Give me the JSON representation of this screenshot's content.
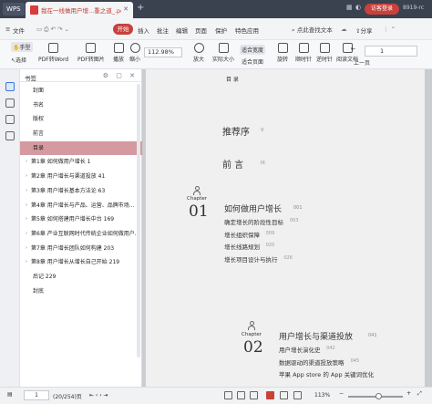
{
  "titlebar": {
    "app_name": "WPS",
    "doc_tab_title": "我在一线做用户增...重之道_.pdf",
    "tab_close": "✕",
    "tab_add": "+",
    "login_label": "访客登录",
    "user_id": "8919-rc"
  },
  "menubar": {
    "file_label": "文件",
    "items": [
      "开始",
      "插入",
      "批注",
      "编辑",
      "页面",
      "保护",
      "特色应用"
    ],
    "start_label": "开始",
    "search_label": "点此查找文本",
    "share_label": "分享"
  },
  "toolbar": {
    "hand_label": "手型",
    "select_label": "选择",
    "pdf_to_word": "PDF转Word",
    "pdf_to_image": "PDF转图片",
    "play_label": "播放",
    "zoom_out_label": "缩小",
    "zoom_value": "112.98%",
    "zoom_in_label": "放大",
    "actual_size_label": "实际大小",
    "fit_width_label": "适合宽度",
    "fit_page_label": "适合页面",
    "rotate_left_label": "旋转",
    "rotate_right_label": "顺时针",
    "view_options_label": "逆时针",
    "read_label": "阅读文档",
    "prev_label": "上一页",
    "page_input": "1"
  },
  "bookmarks": {
    "title": "书签",
    "tools": "⚙ ▢ ✕",
    "items": [
      {
        "label": "封面",
        "expandable": false,
        "selected": false
      },
      {
        "label": "书名",
        "expandable": false,
        "selected": false
      },
      {
        "label": "版权",
        "expandable": false,
        "selected": false
      },
      {
        "label": "前言",
        "expandable": false,
        "selected": false
      },
      {
        "label": "目录",
        "expandable": false,
        "selected": true
      },
      {
        "label": "第1章 如何做用户增长  1",
        "expandable": true,
        "selected": false
      },
      {
        "label": "第2章 用户增长与渠道投放  41",
        "expandable": true,
        "selected": false
      },
      {
        "label": "第3章 用户增长基本方法论  63",
        "expandable": true,
        "selected": false
      },
      {
        "label": "第4章 用户增长与产品、运营、品牌市场...",
        "expandable": true,
        "selected": false
      },
      {
        "label": "第5章 如何搭建用户增长中台  169",
        "expandable": true,
        "selected": false
      },
      {
        "label": "第6章 产业互联网时代传统企业如何做用户...",
        "expandable": true,
        "selected": false
      },
      {
        "label": "第7章 用户增长团队如何构建  203",
        "expandable": true,
        "selected": false
      },
      {
        "label": "第8章 用户增长从增长自己开始  219",
        "expandable": true,
        "selected": false
      },
      {
        "label": "后记  229",
        "expandable": false,
        "selected": false
      },
      {
        "label": "封底",
        "expandable": false,
        "selected": false
      }
    ]
  },
  "page": {
    "header": "目  录",
    "recommend": "推荐序",
    "recommend_page": "V",
    "preface": "前  言",
    "preface_page": "IX",
    "chapter_word": "Chapter",
    "ch1_num": "01",
    "ch1_title": "如何做用户增长",
    "ch1_title_page": "001",
    "ch1_sections": [
      {
        "label": "确定增长的阶段性目标",
        "page": "003"
      },
      {
        "label": "增长组织保障",
        "page": "009"
      },
      {
        "label": "增长线路规划",
        "page": "020"
      },
      {
        "label": "增长项目设计与执行",
        "page": "026"
      }
    ],
    "ch2_num": "02",
    "ch2_title": "用户增长与渠道投放",
    "ch2_title_page": "041",
    "ch2_sections": [
      {
        "label": "用户增长演化史",
        "page": "042"
      },
      {
        "label": "数据驱动的渠道投放策略",
        "page": "045"
      },
      {
        "label": "苹果 App store 的 App 关键词优化",
        "page": ""
      }
    ]
  },
  "statusbar": {
    "page_input": "1",
    "page_count": "(20/254)页",
    "zoom_value": "113%"
  }
}
